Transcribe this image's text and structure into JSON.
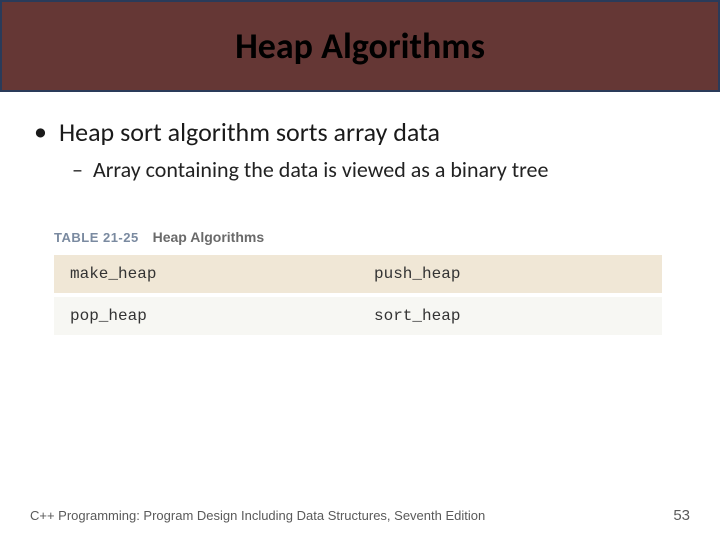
{
  "title": "Heap Algorithms",
  "bullets": {
    "l1": "Heap sort algorithm sorts array data",
    "l2": "Array containing the data is viewed as a binary tree"
  },
  "table": {
    "label": "TABLE 21-25",
    "title": "Heap Algorithms",
    "rows": [
      [
        "make_heap",
        "push_heap"
      ],
      [
        "pop_heap",
        "sort_heap"
      ]
    ]
  },
  "footer": {
    "text": "C++ Programming: Program Design Including Data Structures, Seventh Edition",
    "page": "53"
  }
}
